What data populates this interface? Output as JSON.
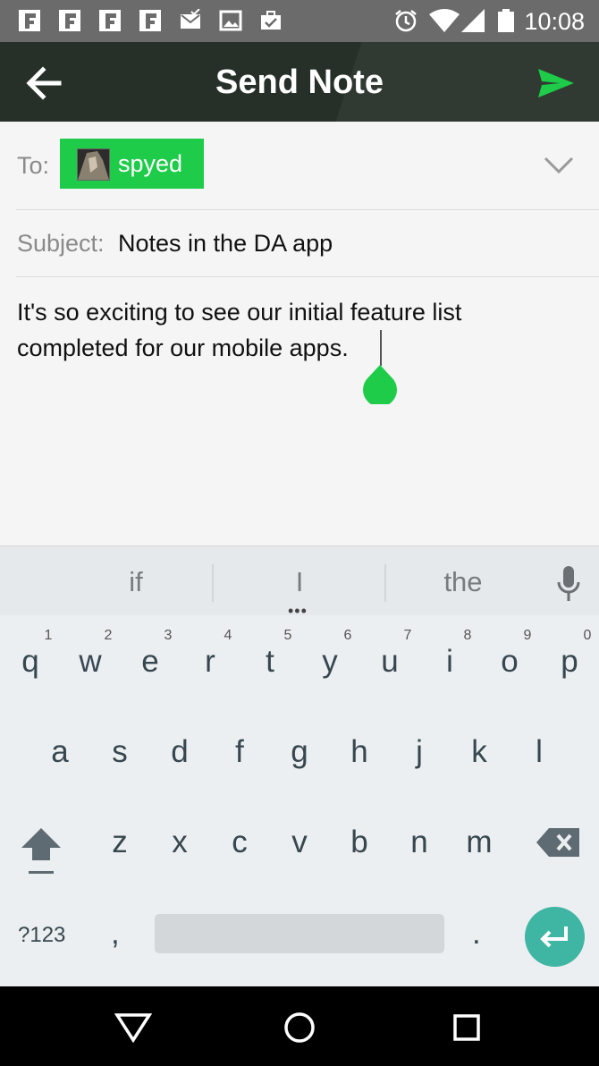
{
  "status_bar": {
    "time": "10:08",
    "icons": [
      "flipboard-icon",
      "flipboard-icon",
      "flipboard-icon",
      "flipboard-icon",
      "mail-check-icon",
      "image-icon",
      "briefcase-check-icon",
      "alarm-icon",
      "wifi-icon",
      "signal-icon",
      "battery-icon"
    ]
  },
  "app_bar": {
    "title": "Send Note",
    "back_icon": "arrow-left-icon",
    "send_icon": "send-icon"
  },
  "form": {
    "to_label": "To:",
    "recipient": "spyed",
    "subject_label": "Subject:",
    "subject_value": "Notes in the DA app",
    "body": "It's so exciting to see our initial feature list\ncompleted for our mobile apps."
  },
  "keyboard": {
    "suggestions": [
      "if",
      "I",
      "the"
    ],
    "rows": [
      [
        "q",
        "w",
        "e",
        "r",
        "t",
        "y",
        "u",
        "i",
        "o",
        "p"
      ],
      [
        "a",
        "s",
        "d",
        "f",
        "g",
        "h",
        "j",
        "k",
        "l"
      ],
      [
        "z",
        "x",
        "c",
        "v",
        "b",
        "n",
        "m"
      ]
    ],
    "number_hints": [
      "1",
      "2",
      "3",
      "4",
      "5",
      "6",
      "7",
      "8",
      "9",
      "0"
    ],
    "symbols_label": "?123",
    "comma": ",",
    "period": "."
  },
  "colors": {
    "accent_green": "#1ecc4a",
    "app_bar": "#263028",
    "enter_key": "#3fb5a3"
  }
}
